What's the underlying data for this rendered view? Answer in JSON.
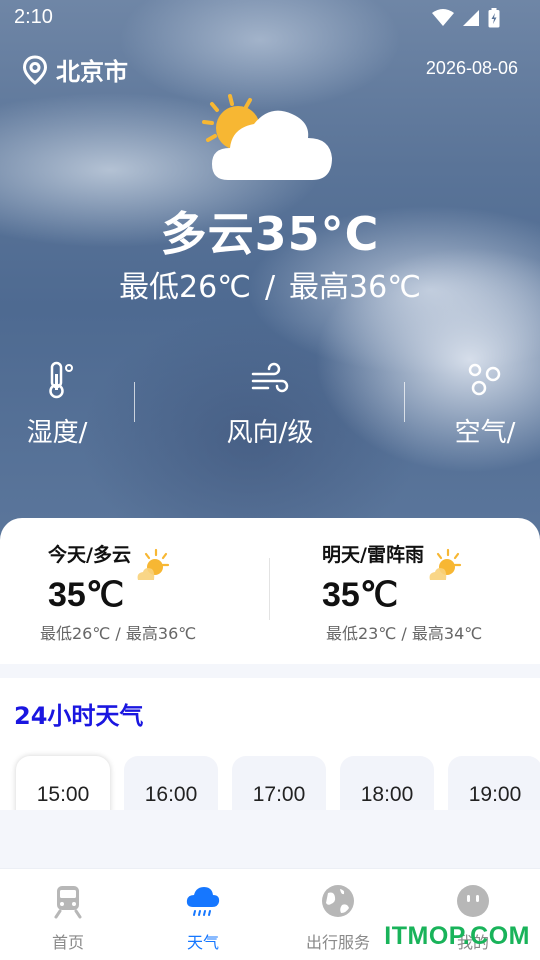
{
  "status_bar": {
    "time": "2:10"
  },
  "header": {
    "city": "北京市",
    "date": "2026-08-06"
  },
  "current": {
    "condition_temp": "多云35°C",
    "low": "最低26℃",
    "separator": "/",
    "high": "最高36℃"
  },
  "metrics": [
    {
      "label": "湿度/",
      "icon": "thermometer-icon"
    },
    {
      "label": "风向/级",
      "icon": "wind-icon"
    },
    {
      "label": "空气/",
      "icon": "drops-icon"
    }
  ],
  "forecast": {
    "today": {
      "title": "今天/多云",
      "temp": "35℃",
      "range": "最低26℃ / 最高36℃"
    },
    "tomorrow": {
      "title": "明天/雷阵雨",
      "temp": "35℃",
      "range": "最低23℃ / 最高34℃"
    }
  },
  "hourly": {
    "title": "24小时天气",
    "hours": [
      "15:00",
      "16:00",
      "17:00",
      "18:00",
      "19:00"
    ],
    "selected_index": 0
  },
  "nav": {
    "items": [
      {
        "label": "首页",
        "icon": "train-icon"
      },
      {
        "label": "天气",
        "icon": "cloud-rain-icon"
      },
      {
        "label": "出行服务",
        "icon": "globe-icon"
      },
      {
        "label": "我的",
        "icon": "face-icon"
      }
    ],
    "active_index": 1
  },
  "watermark": "ITMOP.COM",
  "colors": {
    "accent": "#1677ff",
    "title_blue": "#1a16e0",
    "watermark": "#19b35a",
    "sun": "#f7b733"
  }
}
